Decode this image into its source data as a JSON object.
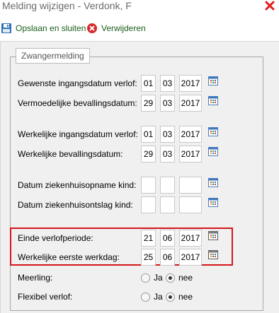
{
  "window": {
    "title": "Melding wijzigen - Verdonk, F",
    "close_icon": "close-icon",
    "close_color": "#e02020"
  },
  "toolbar": {
    "save_label": "Opslaan en sluiten",
    "save_icon": "floppy-disk-icon",
    "delete_label": "Verwijderen",
    "delete_icon": "delete-circle-icon"
  },
  "form": {
    "legend": "Zwangermelding",
    "highlight_color": "#d3161a",
    "date_rows": [
      {
        "label": "Gewenste ingangsdatum verlof:",
        "day": "01",
        "month": "03",
        "year": "2017"
      },
      {
        "label": "Vermoedelijke bevallingsdatum:",
        "day": "29",
        "month": "03",
        "year": "2017"
      },
      {
        "label": "Werkelijke ingangsdatum verlof:",
        "day": "01",
        "month": "03",
        "year": "2017"
      },
      {
        "label": "Werkelijke bevallingsdatum:",
        "day": "29",
        "month": "03",
        "year": "2017"
      },
      {
        "label": "Datum ziekenhuisopname kind:",
        "day": "",
        "month": "",
        "year": ""
      },
      {
        "label": "Datum ziekenhuisontslag kind:",
        "day": "",
        "month": "",
        "year": ""
      },
      {
        "label": "Einde verlofperiode:",
        "day": "21",
        "month": "06",
        "year": "2017"
      },
      {
        "label": "Werkelijke eerste werkdag:",
        "day": "25",
        "month": "06",
        "year": "2017"
      }
    ],
    "radio_rows": [
      {
        "label": "Meerling:",
        "options": [
          "Ja",
          "nee"
        ],
        "selected": "nee"
      },
      {
        "label": "Flexibel verlof:",
        "options": [
          "Ja",
          "nee"
        ],
        "selected": "nee"
      }
    ]
  }
}
